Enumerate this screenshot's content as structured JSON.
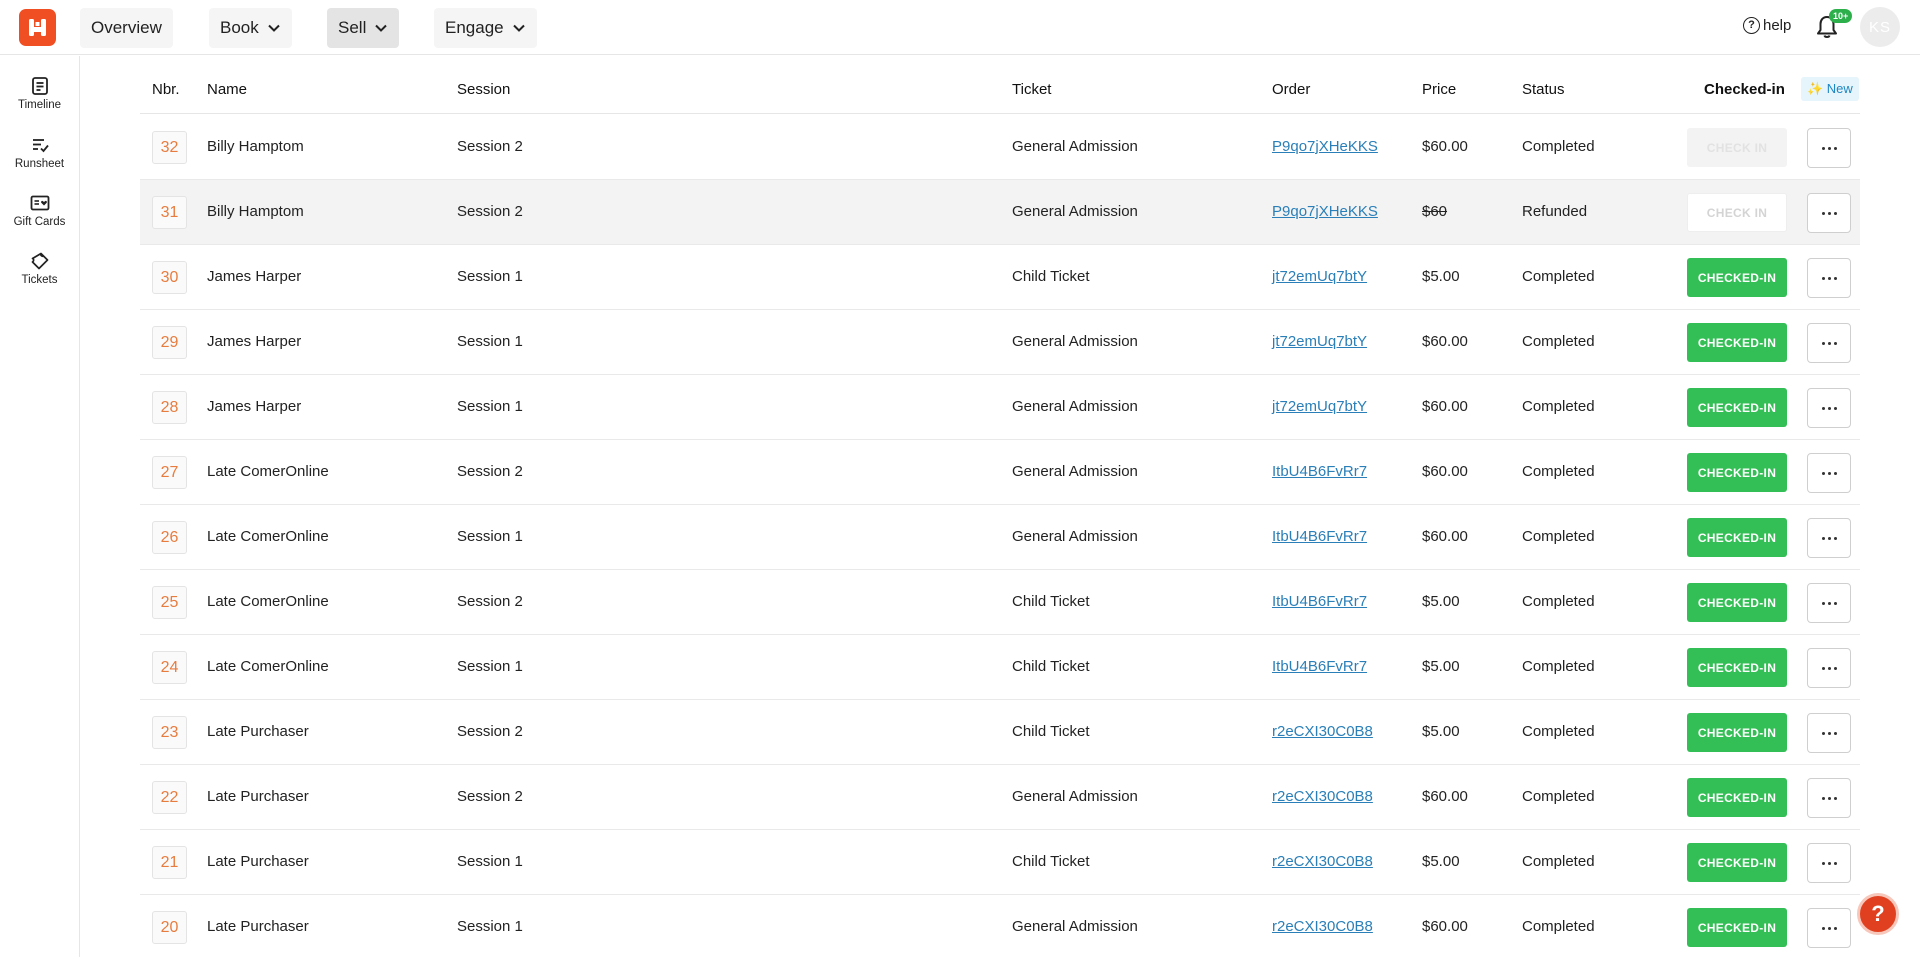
{
  "nav": {
    "overview": "Overview",
    "book": "Book",
    "sell": "Sell",
    "engage": "Engage",
    "help": "help",
    "help_glyph": "?",
    "notif_badge": "10+",
    "avatar_initials": "KS"
  },
  "sidebar": {
    "items": [
      {
        "label": "Timeline",
        "icon": "timeline-icon"
      },
      {
        "label": "Runsheet",
        "icon": "runsheet-icon"
      },
      {
        "label": "Gift Cards",
        "icon": "gift-card-icon"
      },
      {
        "label": "Tickets",
        "icon": "ticket-icon"
      }
    ]
  },
  "table": {
    "headers": {
      "nbr": "Nbr.",
      "name": "Name",
      "session": "Session",
      "ticket": "Ticket",
      "order": "Order",
      "price": "Price",
      "status": "Status",
      "checked_in": "Checked-in",
      "new_badge": "✨ New"
    },
    "rows": [
      {
        "nbr": "32",
        "name": "Billy Hamptom",
        "session": "Session 2",
        "ticket": "General Admission",
        "order": "P9qo7jXHeKKS",
        "price": "$60.00",
        "status": "Completed",
        "checkin": "CHECK IN",
        "checkin_state": "disabled"
      },
      {
        "nbr": "31",
        "name": "Billy Hamptom",
        "session": "Session 2",
        "ticket": "General Admission",
        "order": "P9qo7jXHeKKS",
        "price": "$60",
        "status": "Refunded",
        "checkin": "CHECK IN",
        "checkin_state": "outline"
      },
      {
        "nbr": "30",
        "name": "James Harper",
        "session": "Session 1",
        "ticket": "Child Ticket",
        "order": "jt72emUq7btY",
        "price": "$5.00",
        "status": "Completed",
        "checkin": "CHECKED-IN",
        "checkin_state": "done"
      },
      {
        "nbr": "29",
        "name": "James Harper",
        "session": "Session 1",
        "ticket": "General Admission",
        "order": "jt72emUq7btY",
        "price": "$60.00",
        "status": "Completed",
        "checkin": "CHECKED-IN",
        "checkin_state": "done"
      },
      {
        "nbr": "28",
        "name": "James Harper",
        "session": "Session 1",
        "ticket": "General Admission",
        "order": "jt72emUq7btY",
        "price": "$60.00",
        "status": "Completed",
        "checkin": "CHECKED-IN",
        "checkin_state": "done"
      },
      {
        "nbr": "27",
        "name": "Late ComerOnline",
        "session": "Session 2",
        "ticket": "General Admission",
        "order": "ItbU4B6FvRr7",
        "price": "$60.00",
        "status": "Completed",
        "checkin": "CHECKED-IN",
        "checkin_state": "done"
      },
      {
        "nbr": "26",
        "name": "Late ComerOnline",
        "session": "Session 1",
        "ticket": "General Admission",
        "order": "ItbU4B6FvRr7",
        "price": "$60.00",
        "status": "Completed",
        "checkin": "CHECKED-IN",
        "checkin_state": "done"
      },
      {
        "nbr": "25",
        "name": "Late ComerOnline",
        "session": "Session 2",
        "ticket": "Child Ticket",
        "order": "ItbU4B6FvRr7",
        "price": "$5.00",
        "status": "Completed",
        "checkin": "CHECKED-IN",
        "checkin_state": "done"
      },
      {
        "nbr": "24",
        "name": "Late ComerOnline",
        "session": "Session 1",
        "ticket": "Child Ticket",
        "order": "ItbU4B6FvRr7",
        "price": "$5.00",
        "status": "Completed",
        "checkin": "CHECKED-IN",
        "checkin_state": "done"
      },
      {
        "nbr": "23",
        "name": "Late Purchaser",
        "session": "Session 2",
        "ticket": "Child Ticket",
        "order": "r2eCXI30C0B8",
        "price": "$5.00",
        "status": "Completed",
        "checkin": "CHECKED-IN",
        "checkin_state": "done"
      },
      {
        "nbr": "22",
        "name": "Late Purchaser",
        "session": "Session 2",
        "ticket": "General Admission",
        "order": "r2eCXI30C0B8",
        "price": "$60.00",
        "status": "Completed",
        "checkin": "CHECKED-IN",
        "checkin_state": "done"
      },
      {
        "nbr": "21",
        "name": "Late Purchaser",
        "session": "Session 1",
        "ticket": "Child Ticket",
        "order": "r2eCXI30C0B8",
        "price": "$5.00",
        "status": "Completed",
        "checkin": "CHECKED-IN",
        "checkin_state": "done"
      },
      {
        "nbr": "20",
        "name": "Late Purchaser",
        "session": "Session 1",
        "ticket": "General Admission",
        "order": "r2eCXI30C0B8",
        "price": "$60.00",
        "status": "Completed",
        "checkin": "CHECKED-IN",
        "checkin_state": "done"
      }
    ]
  },
  "fab": {
    "glyph": "?",
    "icon": "help-icon"
  },
  "colors": {
    "brand": "#f04e23",
    "checked_in": "#33bf55",
    "link": "#2a7fb8",
    "nbr_text": "#e87c3e"
  }
}
